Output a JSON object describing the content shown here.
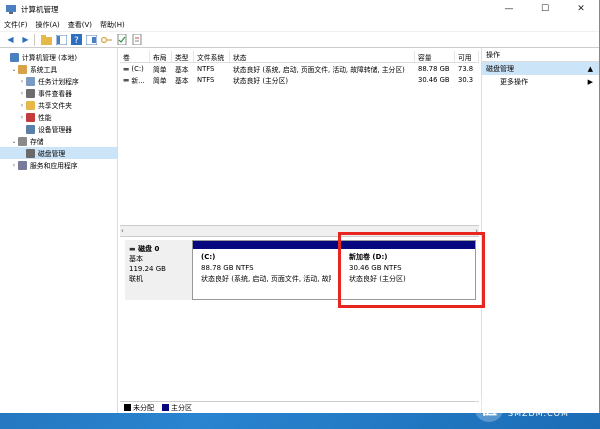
{
  "window": {
    "title": "计算机管理"
  },
  "menu": [
    "文件(F)",
    "操作(A)",
    "查看(V)",
    "帮助(H)"
  ],
  "tree": [
    {
      "label": "计算机管理 (本地)",
      "indent": 0,
      "arrow": "",
      "icon": "computer-management-icon",
      "color": "#4a7fc0"
    },
    {
      "label": "系统工具",
      "indent": 1,
      "arrow": "⌄",
      "icon": "tools-icon",
      "color": "#d8a24a"
    },
    {
      "label": "任务计划程序",
      "indent": 2,
      "arrow": "›",
      "icon": "clock-icon",
      "color": "#7a9bbf"
    },
    {
      "label": "事件查看器",
      "indent": 2,
      "arrow": "›",
      "icon": "event-viewer-icon",
      "color": "#6d6d6d"
    },
    {
      "label": "共享文件夹",
      "indent": 2,
      "arrow": "›",
      "icon": "shared-folder-icon",
      "color": "#e6b84a"
    },
    {
      "label": "性能",
      "indent": 2,
      "arrow": "›",
      "icon": "performance-icon",
      "color": "#c43b3b"
    },
    {
      "label": "设备管理器",
      "indent": 2,
      "arrow": "",
      "icon": "device-manager-icon",
      "color": "#5a7fa8"
    },
    {
      "label": "存储",
      "indent": 1,
      "arrow": "⌄",
      "icon": "storage-icon",
      "color": "#8a8a8a"
    },
    {
      "label": "磁盘管理",
      "indent": 2,
      "arrow": "",
      "icon": "disk-management-icon",
      "color": "#6a6a6a",
      "selected": true
    },
    {
      "label": "服务和应用程序",
      "indent": 1,
      "arrow": "›",
      "icon": "services-icon",
      "color": "#7a7a9a"
    }
  ],
  "volume_table": {
    "headers": [
      "卷",
      "布局",
      "类型",
      "文件系统",
      "状态",
      "容量",
      "可用"
    ],
    "rows": [
      [
        "(C:)",
        "简单",
        "基本",
        "NTFS",
        "状态良好 (系统, 启动, 页面文件, 活动, 故障转储, 主分区)",
        "88.78 GB",
        "73.8"
      ],
      [
        "新...",
        "简单",
        "基本",
        "NTFS",
        "状态良好 (主分区)",
        "30.46 GB",
        "30.3"
      ]
    ]
  },
  "disk": {
    "name": "磁盘 0",
    "type": "基本",
    "size": "119.24 GB",
    "status": "联机"
  },
  "partitions": [
    {
      "name": "(C:)",
      "size": "88.78 GB NTFS",
      "status": "状态良好 (系统, 启动, 页面文件, 活动, 故障转",
      "color": "#06067f"
    },
    {
      "name": "新加卷  (D:)",
      "size": "30.46 GB NTFS",
      "status": "状态良好 (主分区)",
      "color": "#06067f"
    }
  ],
  "legend": [
    {
      "label": "未分配",
      "color": "#000000"
    },
    {
      "label": "主分区",
      "color": "#06067f"
    }
  ],
  "actions": {
    "header": "操作",
    "section": "磁盘管理",
    "more": "更多操作"
  },
  "watermark": {
    "cn": "什么值得买",
    "en": "SMZDM.COM",
    "logo": "值"
  }
}
